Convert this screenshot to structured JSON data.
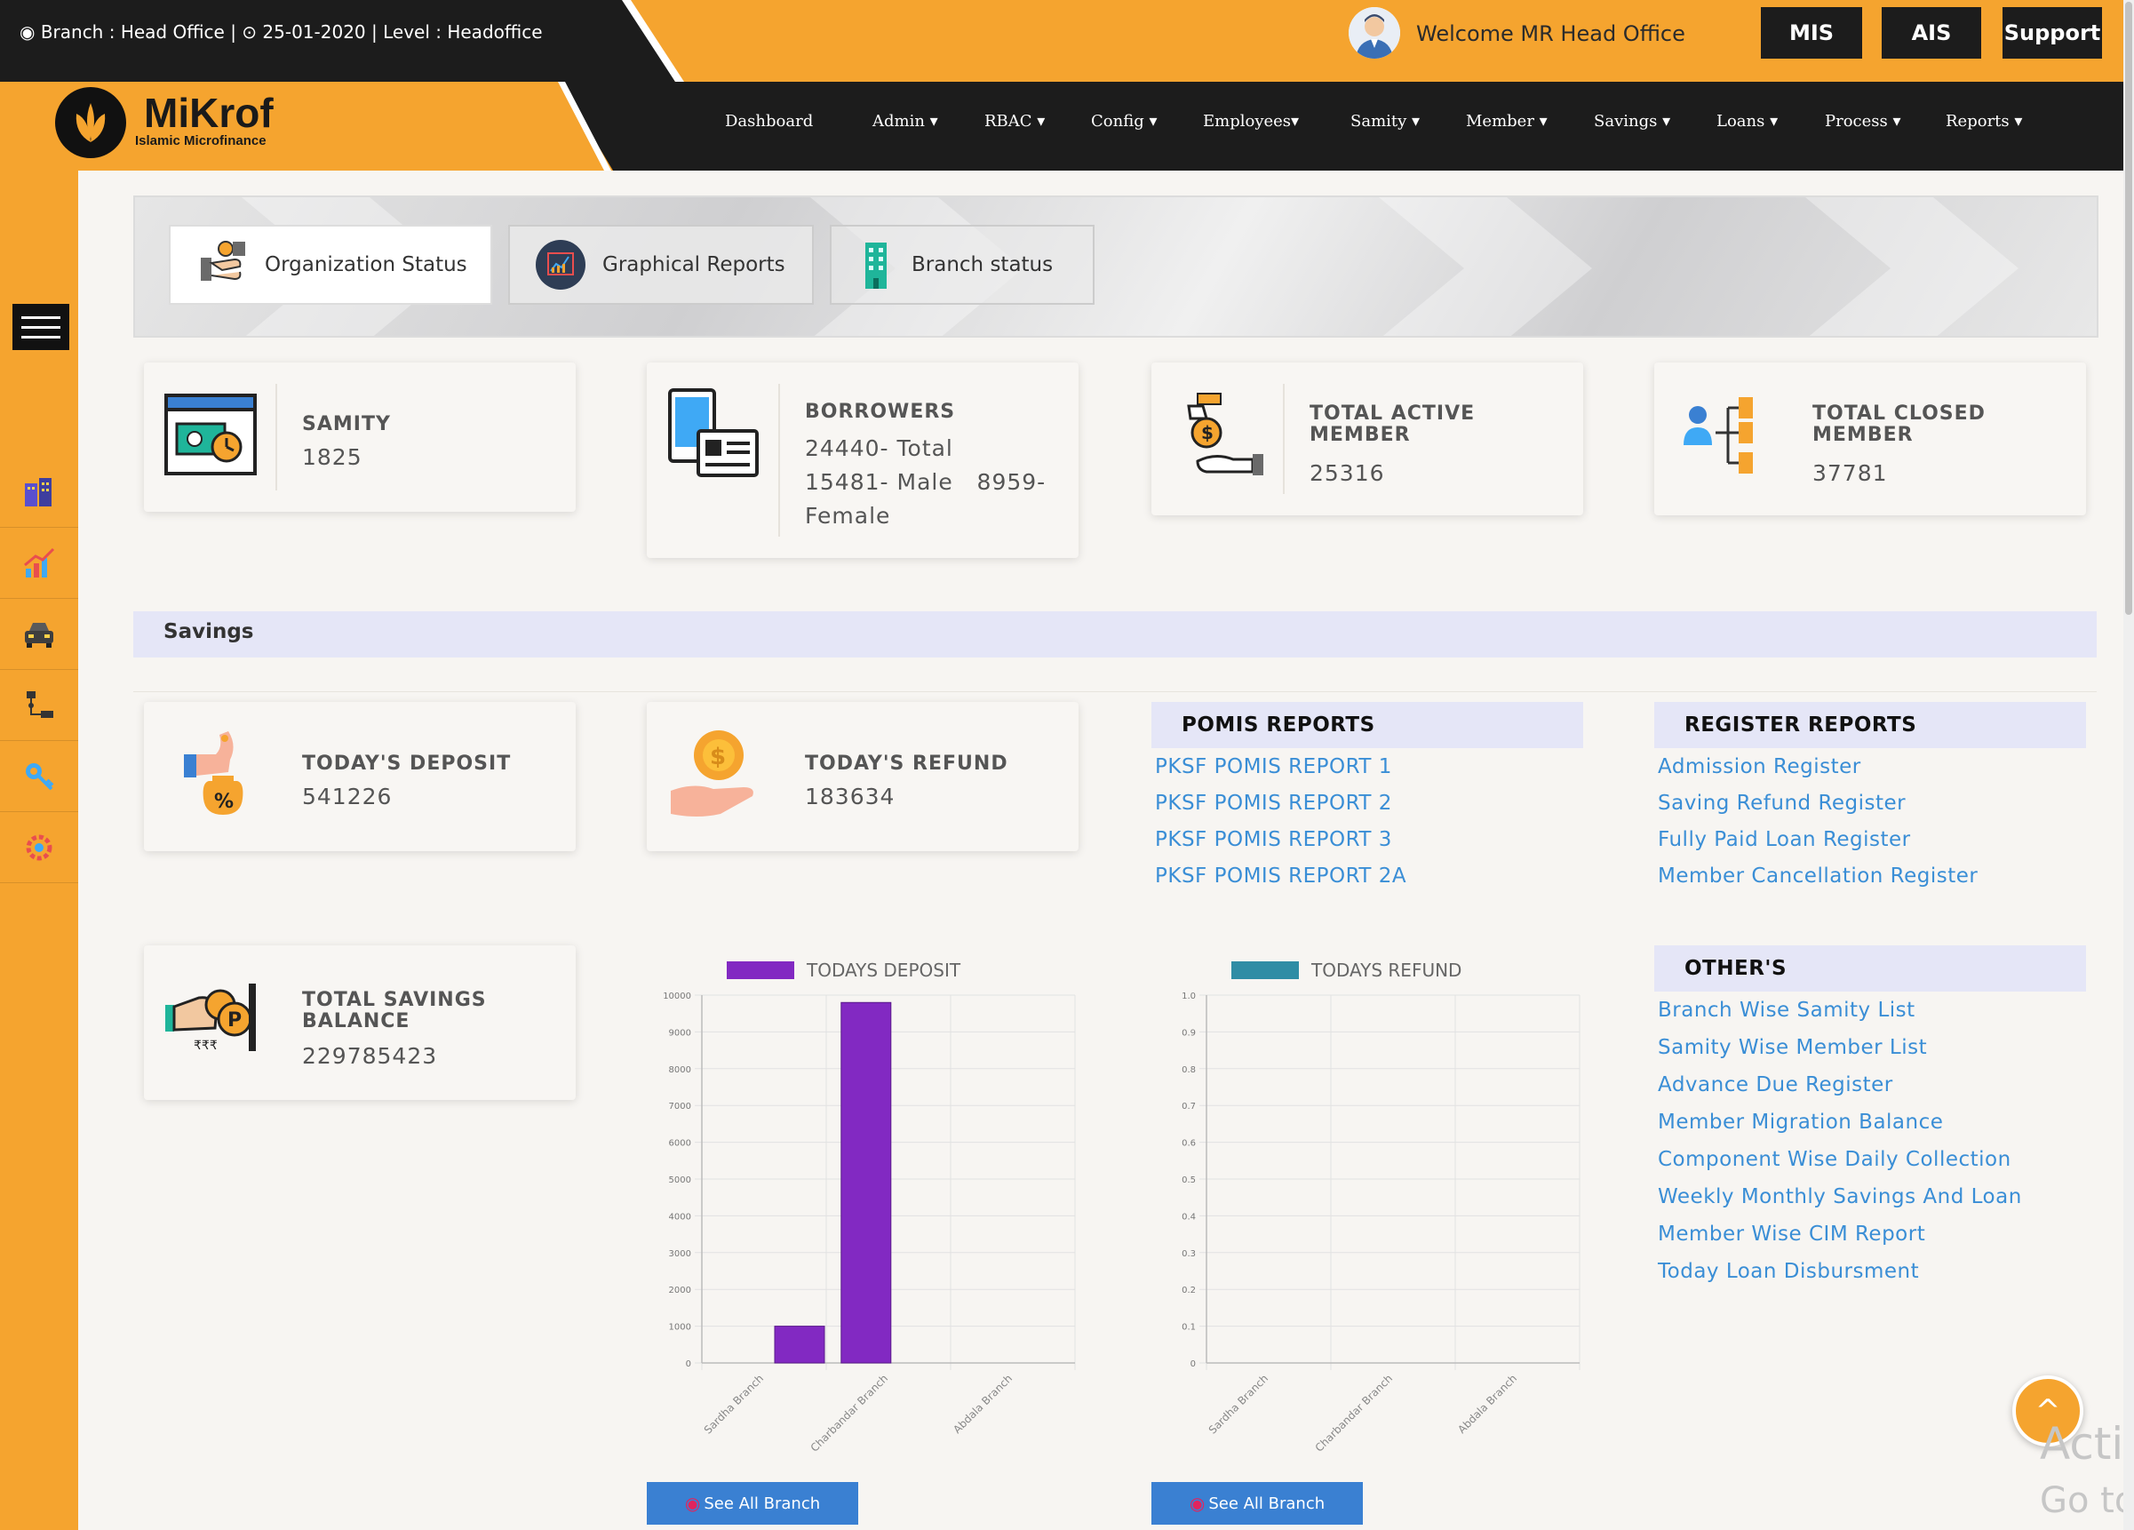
{
  "topbar": {
    "branch_info": "Branch : Head Office |  ⊙ 25-01-2020 | Level : Headoffice",
    "welcome": "Welcome MR Head Office",
    "buttons": [
      "MIS",
      "AIS",
      "Support"
    ]
  },
  "logo": {
    "name": "MiKrof",
    "tagline": "Islamic Microfinance"
  },
  "nav": {
    "items": [
      "Dashboard",
      "Admin ▾",
      "RBAC ▾",
      "Config ▾",
      "Employees▾",
      "Samity ▾",
      "Member ▾",
      "Savings ▾",
      "Loans ▾",
      "Process ▾",
      "Reports ▾"
    ]
  },
  "sidebar": {
    "icons": [
      "building-icon",
      "chart-growth-icon",
      "car-icon",
      "hierarchy-icon",
      "key-icon",
      "settings-icon"
    ]
  },
  "tabs": [
    "Organization Status",
    "Graphical Reports",
    "Branch status"
  ],
  "stats": {
    "samity": {
      "label": "SAMITY",
      "value": "1825"
    },
    "borrowers": {
      "label": "BORROWERS",
      "line1": "24440- Total",
      "line2": "15481- Male   8959-",
      "line3": "Female"
    },
    "active": {
      "label1": "TOTAL ACTIVE",
      "label2": "MEMBER",
      "value": "25316"
    },
    "closed": {
      "label1": "TOTAL CLOSED",
      "label2": "MEMBER",
      "value": "37781"
    }
  },
  "savings": {
    "title": "Savings",
    "deposit": {
      "label": "TODAY'S DEPOSIT",
      "value": "541226"
    },
    "refund": {
      "label": "TODAY'S REFUND",
      "value": "183634"
    },
    "balance": {
      "label1": "TOTAL SAVINGS",
      "label2": "BALANCE",
      "value": "229785423"
    }
  },
  "pomis": {
    "title": "POMIS REPORTS",
    "links": [
      "PKSF POMIS REPORT 1",
      "PKSF POMIS REPORT 2",
      "PKSF POMIS REPORT 3",
      "PKSF POMIS REPORT 2A"
    ]
  },
  "register": {
    "title": "REGISTER REPORTS",
    "links": [
      "Admission Register",
      "Saving Refund Register",
      "Fully Paid Loan Register",
      "Member Cancellation Register"
    ]
  },
  "others": {
    "title": "OTHER'S",
    "links": [
      "Branch Wise Samity List",
      "Samity Wise Member List",
      "Advance Due Register",
      "Member Migration Balance",
      "Component Wise Daily Collection",
      "Weekly Monthly Savings And Loan",
      "Member Wise CIM Report",
      "Today Loan Disbursment"
    ]
  },
  "chart_data": [
    {
      "type": "bar",
      "title": "",
      "legend": "TODAYS DEPOSIT",
      "color": "#8229c2",
      "categories": [
        "Sardha Branch",
        "Charbandar Branch",
        "Abdala Branch"
      ],
      "values": [
        1000,
        9800,
        0
      ],
      "yticks": [
        "0",
        "1000",
        "2000",
        "3000",
        "4000",
        "5000",
        "6000",
        "7000",
        "8000",
        "9000",
        "10000"
      ],
      "ylim": [
        0,
        10000
      ],
      "grid": true,
      "legend_position": "top"
    },
    {
      "type": "bar",
      "title": "",
      "legend": "TODAYS REFUND",
      "color": "#2f8da5",
      "categories": [
        "Sardha Branch",
        "Charbandar Branch",
        "Abdala Branch"
      ],
      "values": [
        0,
        0,
        0
      ],
      "yticks": [
        "0",
        "0.1",
        "0.2",
        "0.3",
        "0.4",
        "0.5",
        "0.6",
        "0.7",
        "0.8",
        "0.9",
        "1.0"
      ],
      "ylim": [
        0,
        1
      ],
      "grid": true,
      "legend_position": "top"
    }
  ],
  "see_all": "See All Branch",
  "scroll_top": "^",
  "watermark": {
    "line1": "Activ",
    "line2": "Go to"
  }
}
